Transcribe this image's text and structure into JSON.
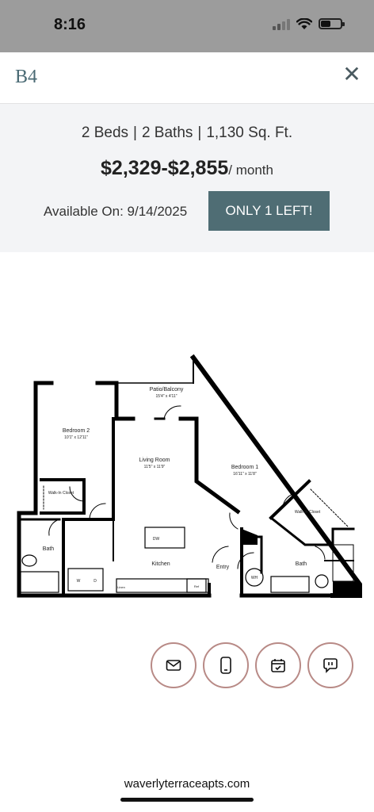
{
  "status_bar": {
    "time": "8:16"
  },
  "modal": {
    "unit_title": "B4",
    "close_symbol": "✕",
    "specs": {
      "beds": "2 Beds",
      "baths": "2 Baths",
      "sqft": "1,130 Sq. Ft."
    },
    "price": {
      "amount": "$2,329-$2,855",
      "per": "/ month"
    },
    "available": "Available On: 9/14/2025",
    "only_left_label": "ONLY 1 LEFT!"
  },
  "floorplan": {
    "patio": "Patio/Balcony",
    "patio_dim": "15'4\" x 4'11\"",
    "bedroom2": "Bedroom 2",
    "bedroom2_dim": "10'1\" x 12'11\"",
    "living": "Living Room",
    "living_dim": "11'5\" x 11'9\"",
    "bedroom1": "Bedroom 1",
    "bedroom1_dim": "16'11\" x 11'8\"",
    "walkin_left": "Walk-In Closet",
    "walkin_right": "Walk-In Closet",
    "bath_left": "Bath",
    "bath_right": "Bath",
    "kitchen": "Kitchen",
    "entry": "Entry",
    "dw": "DW",
    "w": "W",
    "d": "D",
    "wh": "WH",
    "linen": "Linen",
    "ref": "Ref"
  },
  "actions": [
    {
      "name": "email-icon"
    },
    {
      "name": "phone-icon"
    },
    {
      "name": "calendar-icon"
    },
    {
      "name": "chat-icon"
    }
  ],
  "browser": {
    "url": "waverlyterraceapts.com"
  },
  "colors": {
    "accent": "#4f6d74",
    "action_border": "#b88a86",
    "summary_bg": "#f3f4f6"
  }
}
